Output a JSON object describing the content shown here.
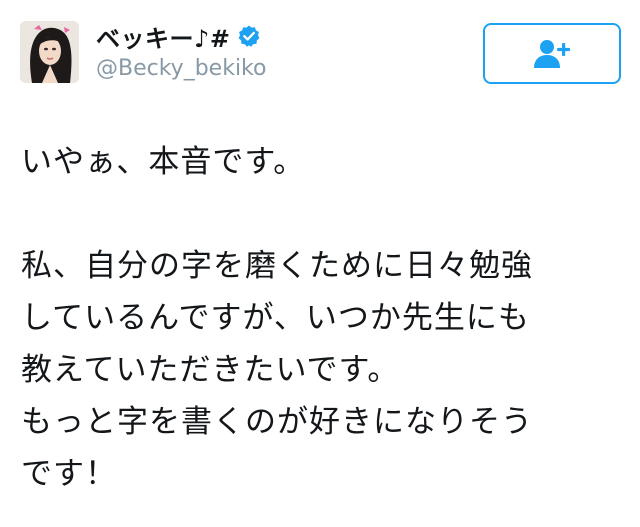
{
  "user": {
    "display_name": "ベッキー♪#",
    "handle": "@Becky_bekiko",
    "verified": true,
    "avatar": "profile-photo"
  },
  "actions": {
    "follow_icon": "add-user-icon"
  },
  "tweet": {
    "lines": [
      "いやぁ、本音です。",
      "",
      "私、自分の字を磨くために日々勉強",
      "しているんですが、いつか先生にも",
      "教えていただきたいです。",
      "もっと字を書くのが好きになりそう",
      "です！"
    ]
  },
  "colors": {
    "accent": "#1da1f2",
    "handle": "#8899a6",
    "text": "#14171a"
  }
}
